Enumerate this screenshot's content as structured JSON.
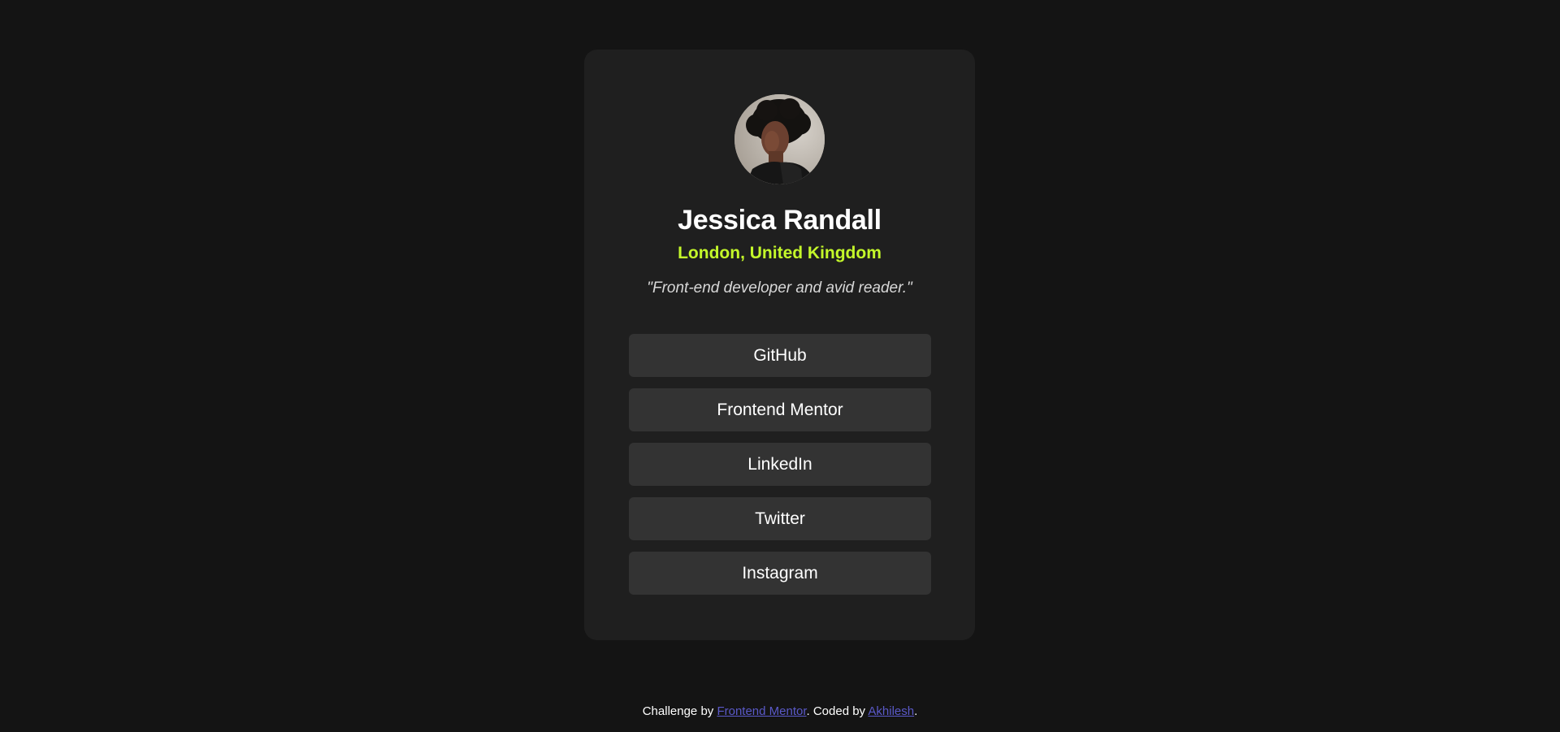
{
  "profile": {
    "avatar_alt": "Jessica Randall",
    "name": "Jessica Randall",
    "location": "London, United Kingdom",
    "bio": "\"Front-end developer and avid reader.\""
  },
  "links": [
    {
      "label": "GitHub"
    },
    {
      "label": "Frontend Mentor"
    },
    {
      "label": "LinkedIn"
    },
    {
      "label": "Twitter"
    },
    {
      "label": "Instagram"
    }
  ],
  "footer": {
    "prefix": "Challenge by ",
    "challenge_link": "Frontend Mentor",
    "middle": ". Coded by ",
    "author_link": "Akhilesh",
    "suffix": "."
  },
  "colors": {
    "background": "#141414",
    "card": "#1f1f1f",
    "button": "#333333",
    "accent": "#c4f82a",
    "footer_link": "#5a59c8"
  }
}
